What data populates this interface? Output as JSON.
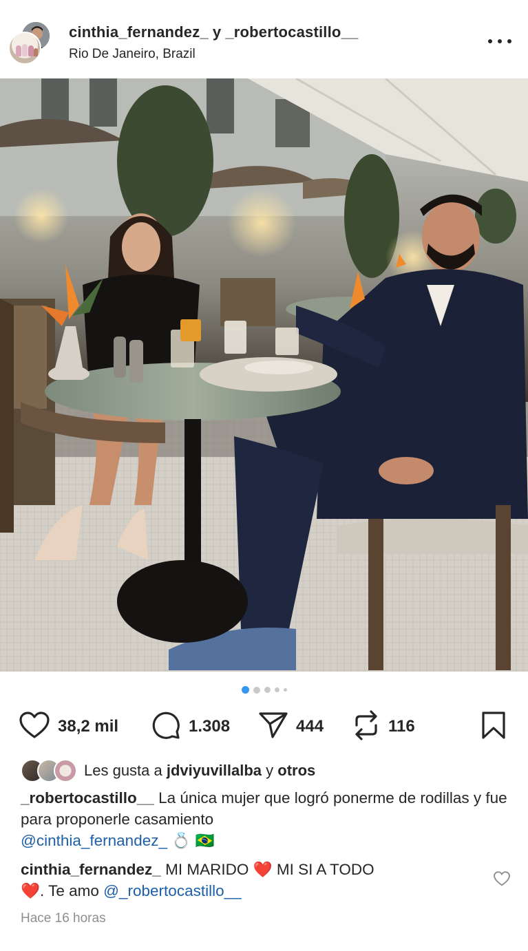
{
  "post": {
    "author_1": "cinthia_fernandez_",
    "joiner": "y",
    "author_2": "_robertocastillo__",
    "location": "Rio De Janeiro, Brazil",
    "more_icon": "more-horizontal-icon"
  },
  "carousel": {
    "total": 5,
    "active": 1
  },
  "actions": {
    "likes": "38,2 mil",
    "comments": "1.308",
    "shares": "444",
    "reposts": "116"
  },
  "liked_by": {
    "prefix": "Les gusta a",
    "user": "jdviyuvillalba",
    "joiner": "y",
    "others": "otros"
  },
  "caption": {
    "user": "_robertocastillo__",
    "text": "La única mujer que logró ponerme de rodillas y fue para proponerle casamiento",
    "mention": "@cinthia_fernandez_",
    "emoji": "💍 🇧🇷"
  },
  "comment": {
    "user": "cinthia_fernandez_",
    "text_1": "MI MARIDO",
    "heart_1": "❤️",
    "text_2": "MI SI A TODO",
    "heart_2": "❤️",
    "text_3": ". Te amo",
    "mention": "@_robertocastillo__"
  },
  "timestamp": "Hace 16 horas",
  "colors": {
    "text": "#262626",
    "link": "#1d5fa8",
    "muted": "#8e8e8e",
    "carousel_active": "#3897f0",
    "heart": "#e0245e"
  }
}
